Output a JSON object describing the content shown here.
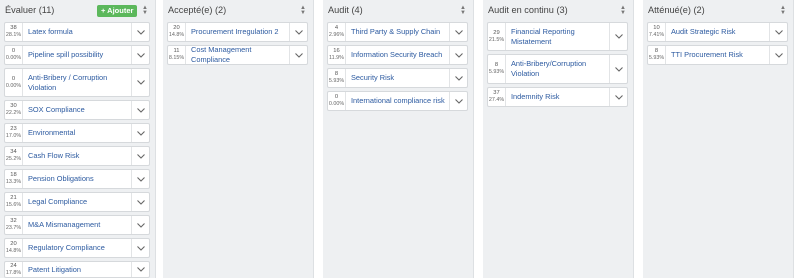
{
  "columns": [
    {
      "title": "Évaluer (11)",
      "add_label": "+ Ajouter",
      "cards": [
        {
          "score": "38",
          "pct": "28.1%",
          "label": "Latex formula"
        },
        {
          "score": "0",
          "pct": "0.00%",
          "label": "Pipeline spill possibility"
        },
        {
          "score": "0",
          "pct": "0.00%",
          "label": "Anti-Bribery / Corruption Violation"
        },
        {
          "score": "30",
          "pct": "22.2%",
          "label": "SOX Compliance"
        },
        {
          "score": "23",
          "pct": "17.0%",
          "label": "Environmental"
        },
        {
          "score": "34",
          "pct": "25.2%",
          "label": "Cash Flow Risk"
        },
        {
          "score": "18",
          "pct": "13.3%",
          "label": "Pension Obligations"
        },
        {
          "score": "21",
          "pct": "15.6%",
          "label": "Legal Compliance"
        },
        {
          "score": "32",
          "pct": "23.7%",
          "label": "M&A Mismanagement"
        },
        {
          "score": "20",
          "pct": "14.8%",
          "label": "Regulatory Compliance"
        },
        {
          "score": "24",
          "pct": "17.8%",
          "label": "Patent Litigation"
        }
      ]
    },
    {
      "title": "Accepté(e) (2)",
      "cards": [
        {
          "score": "20",
          "pct": "14.8%",
          "label": "Procurement Irregulation 2"
        },
        {
          "score": "11",
          "pct": "8.15%",
          "label": "Cost Management Compliance"
        }
      ]
    },
    {
      "title": "Audit (4)",
      "cards": [
        {
          "score": "4",
          "pct": "2.96%",
          "label": "Third Party & Supply Chain"
        },
        {
          "score": "16",
          "pct": "11.9%",
          "label": "Information Security Breach"
        },
        {
          "score": "8",
          "pct": "5.93%",
          "label": "Security Risk"
        },
        {
          "score": "0",
          "pct": "0.00%",
          "label": "International compliance risk"
        }
      ]
    },
    {
      "title": "Audit en continu (3)",
      "cards": [
        {
          "score": "29",
          "pct": "21.5%",
          "label": "Financial Reporting Mistatement"
        },
        {
          "score": "8",
          "pct": "5.93%",
          "label": "Anti-Bribery/Corruption Violation"
        },
        {
          "score": "37",
          "pct": "27.4%",
          "label": "Indemnity Risk"
        }
      ]
    },
    {
      "title": "Atténué(e) (2)",
      "cards": [
        {
          "score": "10",
          "pct": "7.41%",
          "label": "Audit Strategic Risk"
        },
        {
          "score": "8",
          "pct": "5.93%",
          "label": "TTI Procurement Risk"
        }
      ]
    }
  ]
}
